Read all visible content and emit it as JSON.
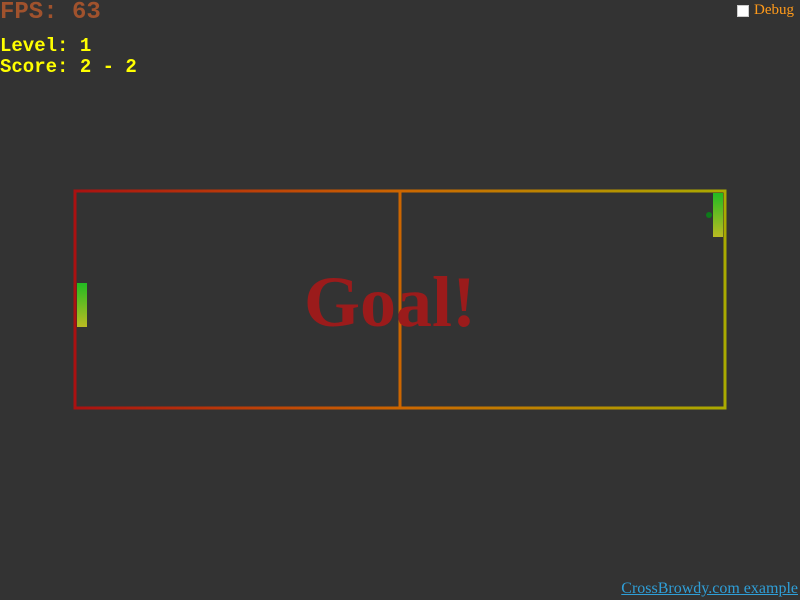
{
  "hud": {
    "fps_text": "FPS: 63",
    "level_text": "Level: 1",
    "score_text": "Score: 2 - 2"
  },
  "debug": {
    "label": "Debug",
    "checked": false
  },
  "field": {
    "message": "Goal!",
    "gradient_start": "#aa1111",
    "gradient_mid": "#cc6600",
    "gradient_end": "#aaaa00",
    "message_color": "#9b1b1b",
    "ball_color": "#0d7a1a",
    "paddle_top_color": "#22bb22",
    "paddle_bottom_color": "#bbbb22"
  },
  "footer": {
    "link_text": "CrossBrowdy.com example"
  }
}
